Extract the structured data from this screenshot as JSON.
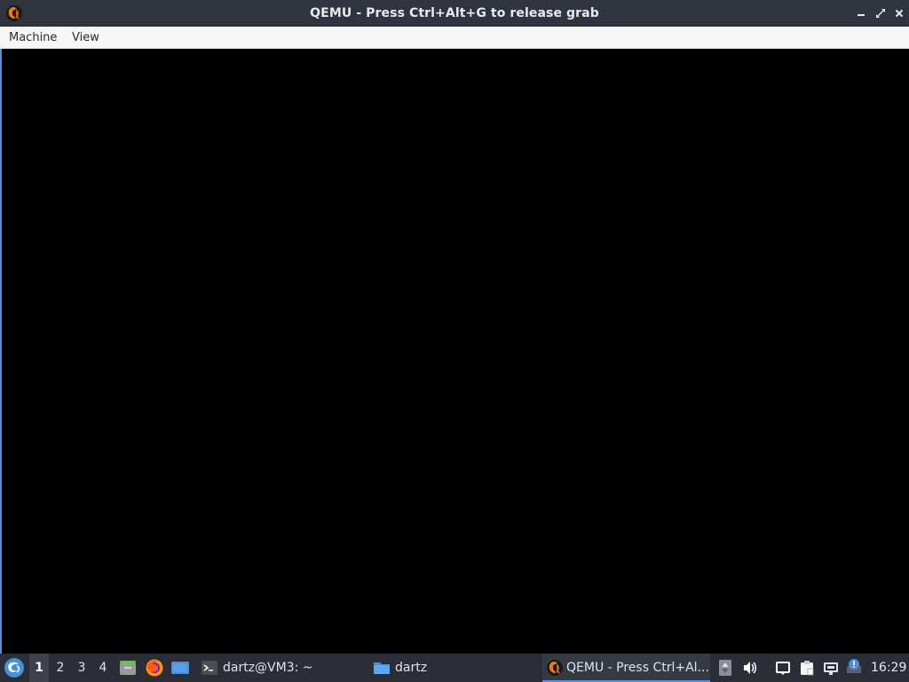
{
  "window": {
    "title": "QEMU - Press Ctrl+Alt+G to release grab",
    "icon": "qemu-icon",
    "controls": [
      "minimize-icon",
      "maximize-icon",
      "close-icon"
    ]
  },
  "menubar": {
    "items": [
      {
        "label": "Machine"
      },
      {
        "label": "View"
      }
    ]
  },
  "taskbar": {
    "start_icon": "start-menu-icon",
    "workspaces": [
      {
        "label": "1",
        "active": true
      },
      {
        "label": "2",
        "active": false
      },
      {
        "label": "3",
        "active": false
      },
      {
        "label": "4",
        "active": false
      }
    ],
    "launchers": [
      "file-manager-icon",
      "firefox-icon",
      "show-desktop-icon"
    ],
    "tasks": [
      {
        "label": "dartz@VM3: ~",
        "icon": "terminal-icon",
        "active": false
      },
      {
        "label": "dartz",
        "icon": "folder-icon",
        "active": false
      },
      {
        "label": "QEMU - Press Ctrl+Al...",
        "icon": "qemu-icon",
        "active": true
      }
    ],
    "tray": [
      "scroll-arrows-icon",
      "volume-icon",
      "notification-icon",
      "clipboard-icon",
      "network-icon",
      "update-info-icon"
    ],
    "clock": "16:29"
  },
  "colors": {
    "titlebar": "#2f343f",
    "menubar": "#f6f6f6",
    "vm_display": "#000000",
    "taskbar": "#2b2e37",
    "accent": "#5294e2"
  }
}
